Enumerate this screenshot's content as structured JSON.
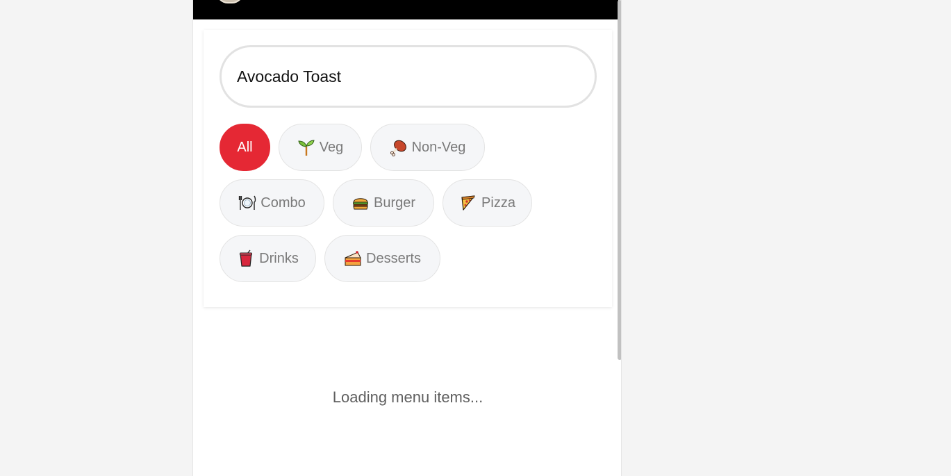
{
  "search": {
    "value": "Avocado Toast"
  },
  "categories": [
    {
      "label": "All",
      "icon": "",
      "active": true
    },
    {
      "label": "Veg",
      "icon": "sprout-icon",
      "active": false
    },
    {
      "label": "Non-Veg",
      "icon": "meat-on-bone-icon",
      "active": false
    },
    {
      "label": "Combo",
      "icon": "plate-cutlery-icon",
      "active": false
    },
    {
      "label": "Burger",
      "icon": "burger-icon",
      "active": false
    },
    {
      "label": "Pizza",
      "icon": "pizza-icon",
      "active": false
    },
    {
      "label": "Drinks",
      "icon": "drink-cup-icon",
      "active": false
    },
    {
      "label": "Desserts",
      "icon": "cake-icon",
      "active": false
    }
  ],
  "status": {
    "loading_text": "Loading menu items..."
  },
  "colors": {
    "accent": "#e52834",
    "chip_bg": "#f5f6f8",
    "topbar": "#000000"
  }
}
